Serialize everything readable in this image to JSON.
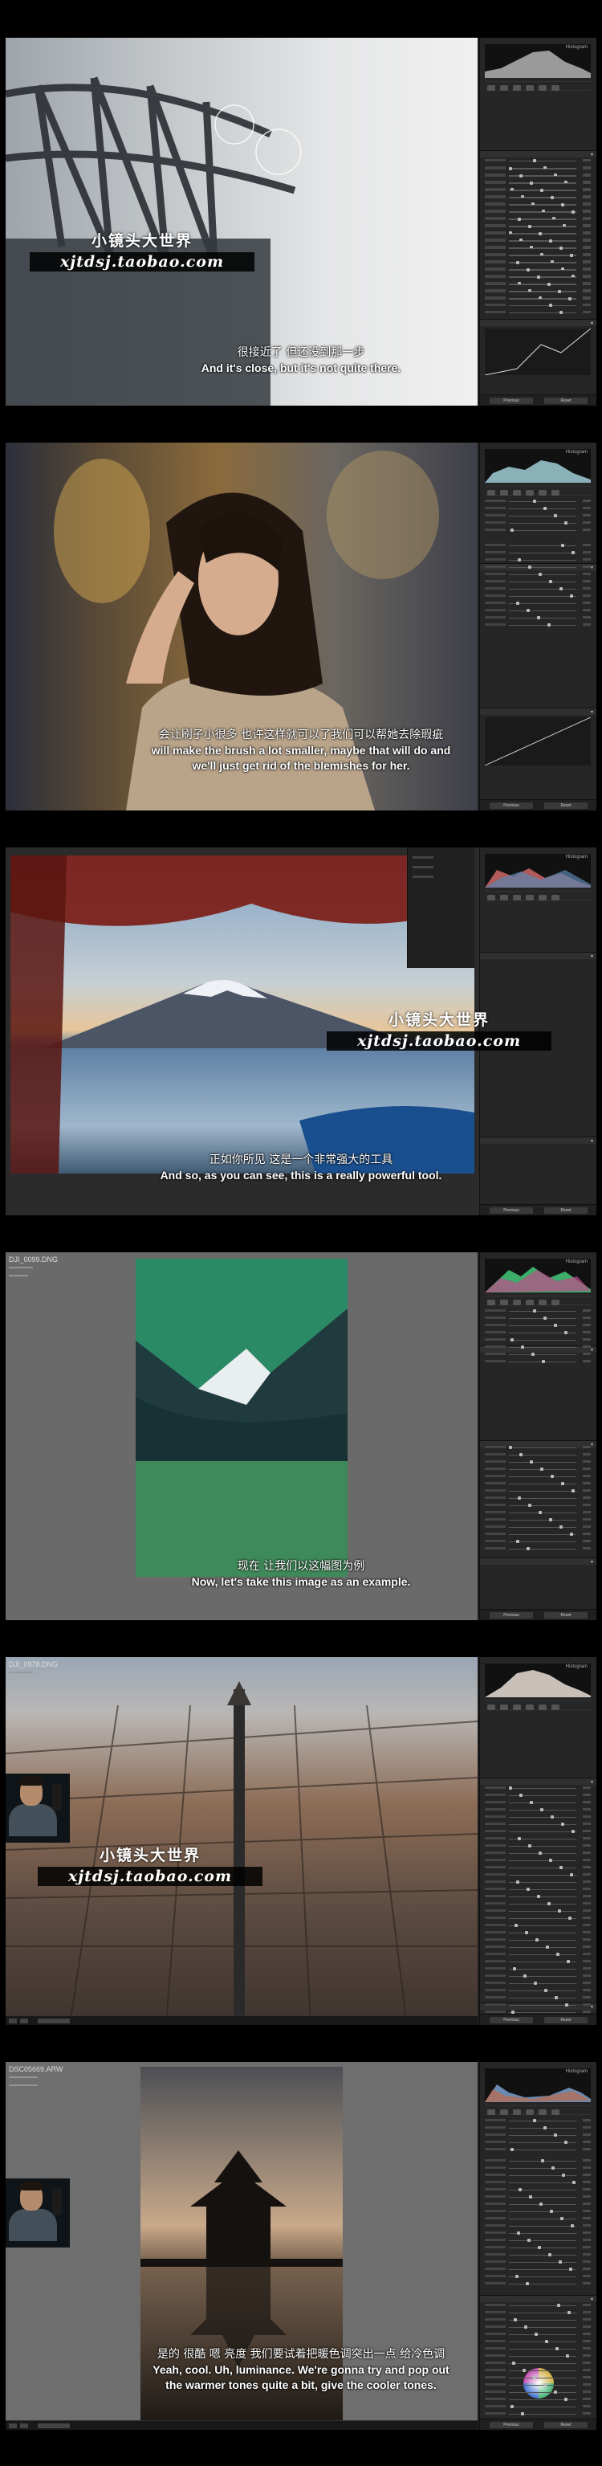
{
  "frames": [
    {
      "subtitle_zh": "很接近了 但还没到那一步",
      "subtitle_en": "And it's close, but it's not quite there.",
      "watermark": {
        "zh": "小镜头大世界",
        "url": "xjtdsj.taobao.com"
      }
    },
    {
      "subtitle_zh": "会让刷子小很多 也许这样就可以了我们可以帮她去除瑕疵",
      "subtitle_en_line1": "will make the brush a lot smaller, maybe that will do and",
      "subtitle_en_line2": "we'll just get rid of the blemishes for her."
    },
    {
      "subtitle_zh": "正如你所见 这是一个非常强大的工具",
      "subtitle_en": "And so, as you can see, this is a really powerful tool.",
      "watermark": {
        "zh": "小镜头大世界",
        "url": "xjtdsj.taobao.com"
      }
    },
    {
      "subtitle_zh": "现在 让我们以这幅图为例",
      "subtitle_en": "Now, let's take this image as an example.",
      "file_name": "DJI_0099.DNG"
    },
    {
      "file_name": "DJI_0978.DNG",
      "watermark": {
        "zh": "小镜头大世界",
        "url": "xjtdsj.taobao.com"
      }
    },
    {
      "file_name": "DSC05669.ARW",
      "subtitle_zh": "是的 很酷 嗯 亮度 我们要试着把暖色调突出一点 给冷色调",
      "subtitle_en_line1": "Yeah, cool. Uh, luminance. We're gonna try and pop out",
      "subtitle_en_line2": "the warmer tones quite a bit, give the cooler tones."
    }
  ],
  "panel": {
    "histogram_label": "Histogram",
    "prev_button": "Previous",
    "reset_button": "Reset"
  },
  "colors": {
    "ui_bg": "#1d1d1d",
    "panel_bg": "#262626",
    "subtitle": "#ffffff"
  }
}
